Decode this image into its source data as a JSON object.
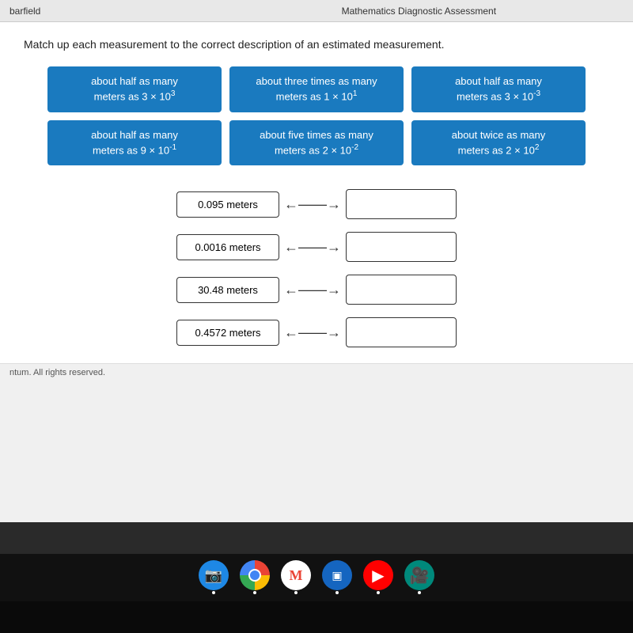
{
  "topbar": {
    "left": "barfield",
    "center": "Mathematics Diagnostic Assessment"
  },
  "instructions": "Match up each measurement to the correct description of an estimated measurement.",
  "options": [
    {
      "id": "opt1",
      "line1": "about half as many",
      "line2": "meters as 3 × 10",
      "sup": "3"
    },
    {
      "id": "opt2",
      "line1": "about three times as many",
      "line2": "meters as 1 × 10",
      "sup": "1"
    },
    {
      "id": "opt3",
      "line1": "about half as many",
      "line2": "meters as 3 × 10",
      "sup": "-3"
    },
    {
      "id": "opt4",
      "line1": "about half as many",
      "line2": "meters as 9 × 10",
      "sup": "-1"
    },
    {
      "id": "opt5",
      "line1": "about five times as many",
      "line2": "meters as 2 × 10",
      "sup": "-2"
    },
    {
      "id": "opt6",
      "line1": "about twice as many",
      "line2": "meters as 2 × 10",
      "sup": "2"
    }
  ],
  "measurements": [
    {
      "id": "m1",
      "value": "0.095 meters"
    },
    {
      "id": "m2",
      "value": "0.0016 meters"
    },
    {
      "id": "m3",
      "value": "30.48 meters"
    },
    {
      "id": "m4",
      "value": "0.4572 meters"
    }
  ],
  "footer": "ntum. All rights reserved.",
  "taskbar": {
    "icons": [
      {
        "name": "camera",
        "symbol": "📷"
      },
      {
        "name": "chrome",
        "symbol": "⊙"
      },
      {
        "name": "gmail",
        "symbol": "M"
      },
      {
        "name": "drive",
        "symbol": "▲"
      },
      {
        "name": "youtube",
        "symbol": "▶"
      },
      {
        "name": "meet",
        "symbol": "🎥"
      }
    ]
  }
}
